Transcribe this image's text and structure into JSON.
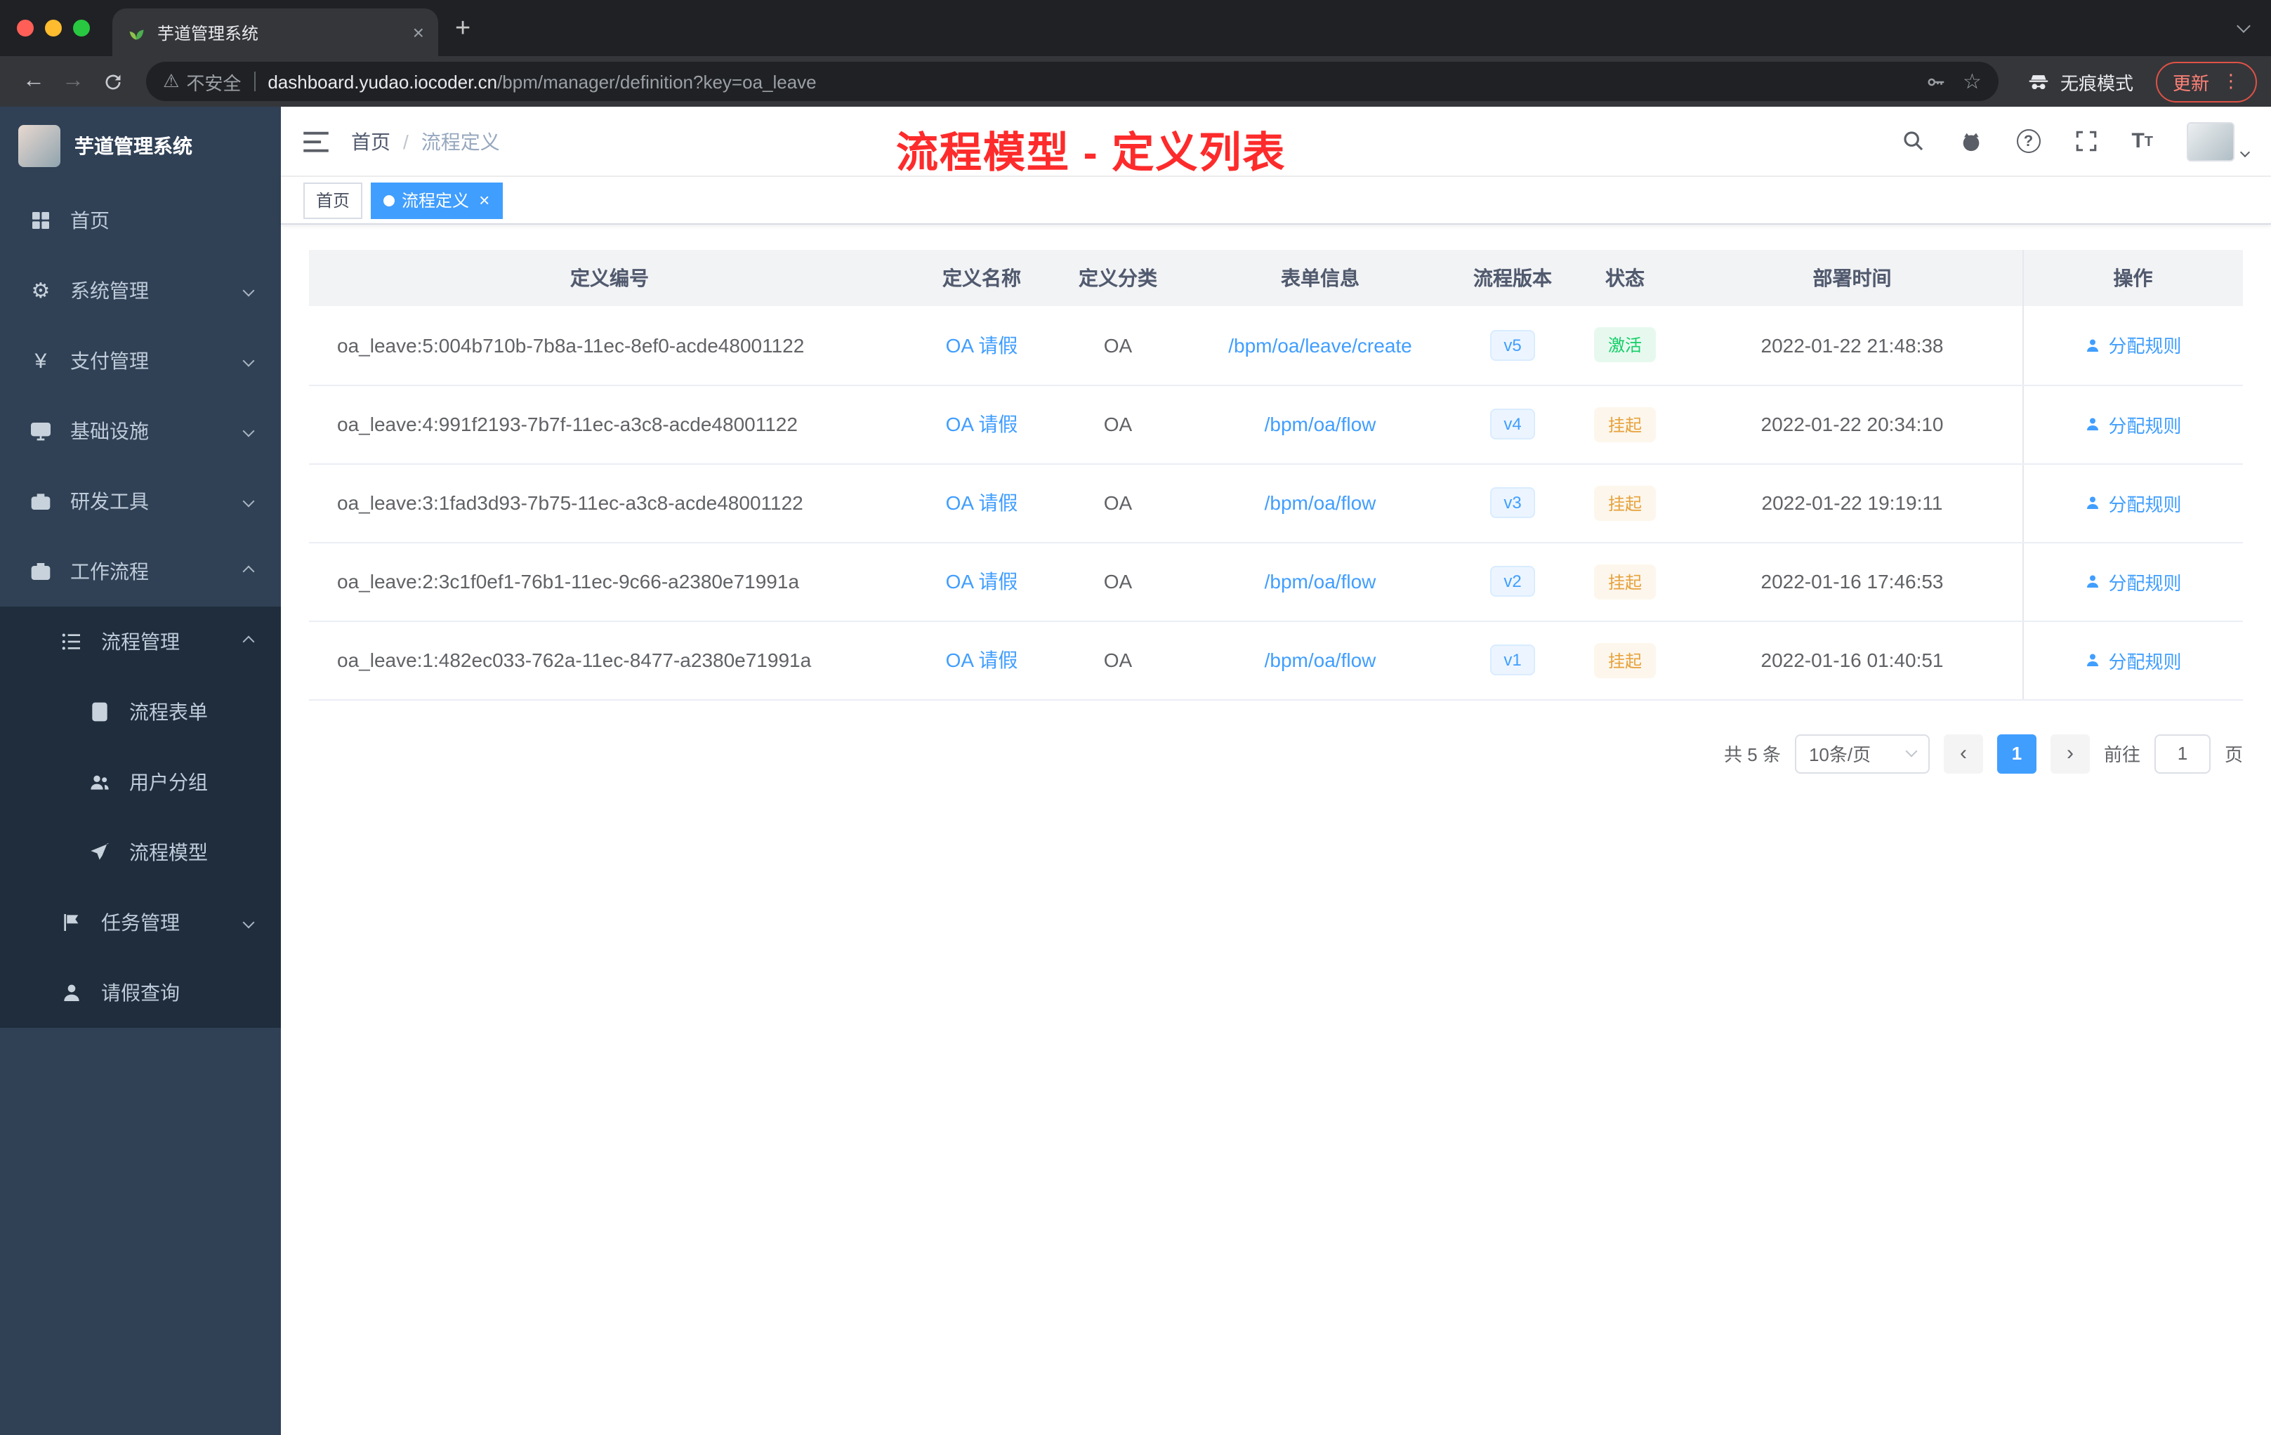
{
  "browser": {
    "tab_title": "芋道管理系统",
    "security_label": "不安全",
    "url_host": "dashboard.yudao.iocoder.cn",
    "url_path": "/bpm/manager/definition?key=oa_leave",
    "incognito_label": "无痕模式",
    "update_label": "更新"
  },
  "icons": {
    "close": "×",
    "new_tab": "+",
    "back": "←",
    "forward": "→",
    "warning": "⚠",
    "star": "☆",
    "more": "⋮",
    "question": "?",
    "font_large": "T",
    "font_small": "T",
    "prev": "‹",
    "next": "›",
    "yen": "¥",
    "gear": "⚙"
  },
  "sidebar": {
    "logo_title": "芋道管理系统",
    "items": [
      {
        "label": "首页"
      },
      {
        "label": "系统管理"
      },
      {
        "label": "支付管理"
      },
      {
        "label": "基础设施"
      },
      {
        "label": "研发工具"
      },
      {
        "label": "工作流程"
      },
      {
        "label": "流程管理"
      },
      {
        "label": "流程表单"
      },
      {
        "label": "用户分组"
      },
      {
        "label": "流程模型"
      },
      {
        "label": "任务管理"
      },
      {
        "label": "请假查询"
      }
    ]
  },
  "header": {
    "breadcrumb_home": "首页",
    "breadcrumb_sep": "/",
    "breadcrumb_current": "流程定义",
    "annotation": "流程模型 - 定义列表"
  },
  "tags": {
    "home": "首页",
    "current": "流程定义"
  },
  "table": {
    "headers": [
      "定义编号",
      "定义名称",
      "定义分类",
      "表单信息",
      "流程版本",
      "状态",
      "部署时间",
      "操作"
    ],
    "rows": [
      {
        "id": "oa_leave:5:004b710b-7b8a-11ec-8ef0-acde48001122",
        "name": "OA 请假",
        "category": "OA",
        "form": "/bpm/oa/leave/create",
        "version": "v5",
        "status": "激活",
        "deploy_time": "2022-01-22 21:48:38",
        "action": "分配规则"
      },
      {
        "id": "oa_leave:4:991f2193-7b7f-11ec-a3c8-acde48001122",
        "name": "OA 请假",
        "category": "OA",
        "form": "/bpm/oa/flow",
        "version": "v4",
        "status": "挂起",
        "deploy_time": "2022-01-22 20:34:10",
        "action": "分配规则"
      },
      {
        "id": "oa_leave:3:1fad3d93-7b75-11ec-a3c8-acde48001122",
        "name": "OA 请假",
        "category": "OA",
        "form": "/bpm/oa/flow",
        "version": "v3",
        "status": "挂起",
        "deploy_time": "2022-01-22 19:19:11",
        "action": "分配规则"
      },
      {
        "id": "oa_leave:2:3c1f0ef1-76b1-11ec-9c66-a2380e71991a",
        "name": "OA 请假",
        "category": "OA",
        "form": "/bpm/oa/flow",
        "version": "v2",
        "status": "挂起",
        "deploy_time": "2022-01-16 17:46:53",
        "action": "分配规则"
      },
      {
        "id": "oa_leave:1:482ec033-762a-11ec-8477-a2380e71991a",
        "name": "OA 请假",
        "category": "OA",
        "form": "/bpm/oa/flow",
        "version": "v1",
        "status": "挂起",
        "deploy_time": "2022-01-16 01:40:51",
        "action": "分配规则"
      }
    ]
  },
  "pagination": {
    "total": "共 5 条",
    "page_size": "10条/页",
    "current": "1",
    "goto_label": "前往",
    "goto_value": "1",
    "unit": "页"
  }
}
